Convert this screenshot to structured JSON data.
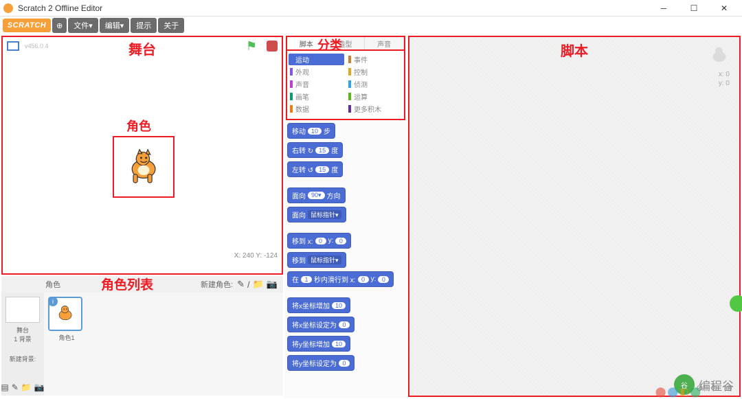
{
  "window": {
    "title": "Scratch 2 Offline Editor",
    "minimize": "─",
    "maximize": "☐",
    "close": "✕"
  },
  "menubar": {
    "logo": "SCRATCH",
    "globe": "⊕",
    "file": "文件▾",
    "edit": "编辑▾",
    "tips": "提示",
    "about": "关于"
  },
  "annotations": {
    "stage": "舞台",
    "sprite_on_stage": "角色",
    "category": "分类",
    "sprite_list": "角色列表",
    "scripts": "脚本"
  },
  "stage": {
    "version": "v456.0.4",
    "flag": "⚑",
    "coords": "X: 240   Y: -124"
  },
  "sprite_list": {
    "header_label": "角色",
    "new_sprite_label": "新建角色:",
    "tool_paint": "✎",
    "tool_lib": "/",
    "tool_upload": "📁",
    "tool_camera": "📷",
    "backdrop_label1": "舞台",
    "backdrop_label2": "1 背景",
    "backdrop_new": "新建背景:",
    "sprite1_name": "角色1",
    "info_icon": "i"
  },
  "tabs": {
    "scripts": "脚本",
    "costumes": "造型",
    "sounds": "声音"
  },
  "categories": [
    {
      "name": "运动",
      "color": "#4a6cd4",
      "selected": true
    },
    {
      "name": "事件",
      "color": "#c88330"
    },
    {
      "name": "外观",
      "color": "#8a55d7"
    },
    {
      "name": "控制",
      "color": "#e1a91a"
    },
    {
      "name": "声音",
      "color": "#bb42c3"
    },
    {
      "name": "侦测",
      "color": "#2ca5e2"
    },
    {
      "name": "画笔",
      "color": "#0e9a6c"
    },
    {
      "name": "运算",
      "color": "#5cb712"
    },
    {
      "name": "数据",
      "color": "#ee7d16"
    },
    {
      "name": "更多积木",
      "color": "#632d99"
    }
  ],
  "blocks": {
    "move": {
      "a": "移动",
      "v": "10",
      "b": "步"
    },
    "turn_r": {
      "a": "右转 ↻",
      "v": "15",
      "b": "度"
    },
    "turn_l": {
      "a": "左转 ↺",
      "v": "15",
      "b": "度"
    },
    "point_dir": {
      "a": "面向",
      "v": "90▾",
      "b": "方向"
    },
    "point_to": {
      "a": "面向",
      "dd": "鼠标指针▾"
    },
    "goto_xy": {
      "a": "移到 x:",
      "v1": "0",
      "b": "y:",
      "v2": "0"
    },
    "goto": {
      "a": "移到",
      "dd": "鼠标指针▾"
    },
    "glide": {
      "a": "在",
      "v1": "1",
      "b": "秒内滑行到 x:",
      "v2": "0",
      "c": "y:",
      "v3": "0"
    },
    "change_x": {
      "a": "将x坐标增加",
      "v": "10"
    },
    "set_x": {
      "a": "将x坐标设定为",
      "v": "0"
    },
    "change_y": {
      "a": "将y坐标增加",
      "v": "10"
    },
    "set_y": {
      "a": "将y坐标设定为",
      "v": "0"
    }
  },
  "scripts_area": {
    "x_label": "x: 0",
    "y_label": "y: 0",
    "zoom": "⊖ ⊜ ⊕"
  },
  "watermark": {
    "avatar": "谷",
    "text": "编程谷"
  }
}
